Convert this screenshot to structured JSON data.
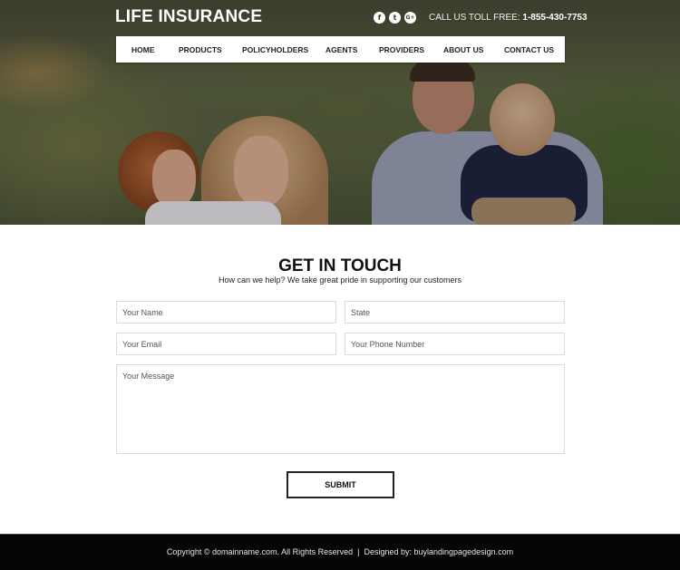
{
  "header": {
    "brand": "LIFE INSURANCE",
    "social": [
      {
        "name": "facebook",
        "glyph": "f"
      },
      {
        "name": "twitter",
        "glyph": "t"
      },
      {
        "name": "google-plus",
        "glyph": "G+"
      }
    ],
    "call_label": "CALL US TOLL FREE:",
    "phone": "1-855-430-7753"
  },
  "nav": {
    "items": [
      {
        "label": "HOME"
      },
      {
        "label": "PRODUCTS"
      },
      {
        "label": "POLICYHOLDERS"
      },
      {
        "label": "AGENTS"
      },
      {
        "label": "PROVIDERS"
      },
      {
        "label": "ABOUT US"
      },
      {
        "label": "CONTACT US"
      }
    ]
  },
  "hero": {
    "image_description": "family of four outdoors: mother with curly-haired child, father holding baby"
  },
  "contact": {
    "title": "GET IN TOUCH",
    "subtitle": "How can we help? We take great pride in supporting our customers",
    "fields": {
      "name": {
        "placeholder": "Your Name",
        "value": ""
      },
      "state": {
        "placeholder": "State",
        "value": ""
      },
      "email": {
        "placeholder": "Your Email",
        "value": ""
      },
      "phone": {
        "placeholder": "Your Phone Number",
        "value": ""
      },
      "message": {
        "placeholder": "Your Message",
        "value": ""
      }
    },
    "submit_label": "SUBMIT"
  },
  "footer": {
    "copyright": "Copyright © domainname.com. All Rights Reserved",
    "separator": "|",
    "designed_by": "Designed by: buylandingpagedesign.com"
  },
  "colors": {
    "footer_bg": "#050505",
    "nav_bg": "#ffffff",
    "text": "#111111"
  }
}
